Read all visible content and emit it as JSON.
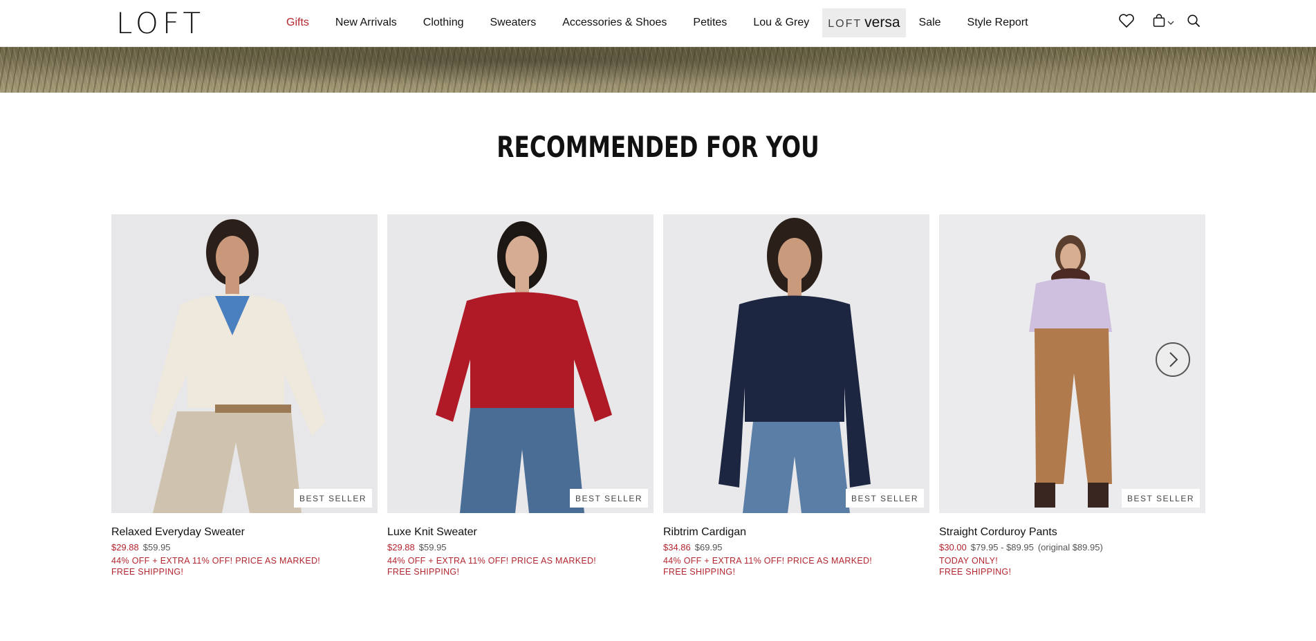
{
  "header": {
    "logo": "LOFT",
    "nav": [
      {
        "label": "Gifts",
        "active": true
      },
      {
        "label": "New Arrivals"
      },
      {
        "label": "Clothing"
      },
      {
        "label": "Sweaters"
      },
      {
        "label": "Accessories & Shoes"
      },
      {
        "label": "Petites"
      },
      {
        "label": "Lou & Grey"
      },
      {
        "label_a": "LOFT",
        "label_b": "versa"
      },
      {
        "label": "Sale"
      },
      {
        "label": "Style Report"
      }
    ],
    "icons": [
      "heart-icon",
      "bag-icon",
      "chevron-down-icon",
      "search-icon"
    ]
  },
  "section": {
    "title": "RECOMMENDED FOR YOU"
  },
  "products": [
    {
      "name": "Relaxed Everyday Sweater",
      "sale_price": "$29.88",
      "original_price": "$59.95",
      "promo": "44% OFF + EXTRA 11% OFF! PRICE AS MARKED!",
      "shipping": "FREE SHIPPING!",
      "badge": "BEST SELLER",
      "sweater_color": "#efe8dc",
      "pants_color": "#cfc3b0"
    },
    {
      "name": "Luxe Knit Sweater",
      "sale_price": "$29.88",
      "original_price": "$59.95",
      "promo": "44% OFF + EXTRA 11% OFF! PRICE AS MARKED!",
      "shipping": "FREE SHIPPING!",
      "badge": "BEST SELLER",
      "sweater_color": "#b01a27",
      "pants_color": "#4a6d96"
    },
    {
      "name": "Ribtrim Cardigan",
      "sale_price": "$34.86",
      "original_price": "$69.95",
      "promo": "44% OFF + EXTRA 11% OFF! PRICE AS MARKED!",
      "shipping": "FREE SHIPPING!",
      "badge": "BEST SELLER",
      "sweater_color": "#1c2641",
      "pants_color": "#5b7ea6"
    },
    {
      "name": "Straight Corduroy Pants",
      "sale_price": "$30.00",
      "original_price": "$79.95 - $89.95",
      "original_note": "(original $89.95)",
      "promo": "TODAY ONLY!",
      "shipping": "FREE SHIPPING!",
      "badge": "BEST SELLER",
      "sweater_color": "#cfc0e0",
      "pants_color": "#b07a4c"
    }
  ],
  "colors": {
    "accent": "#b3262f",
    "text": "#111111"
  }
}
